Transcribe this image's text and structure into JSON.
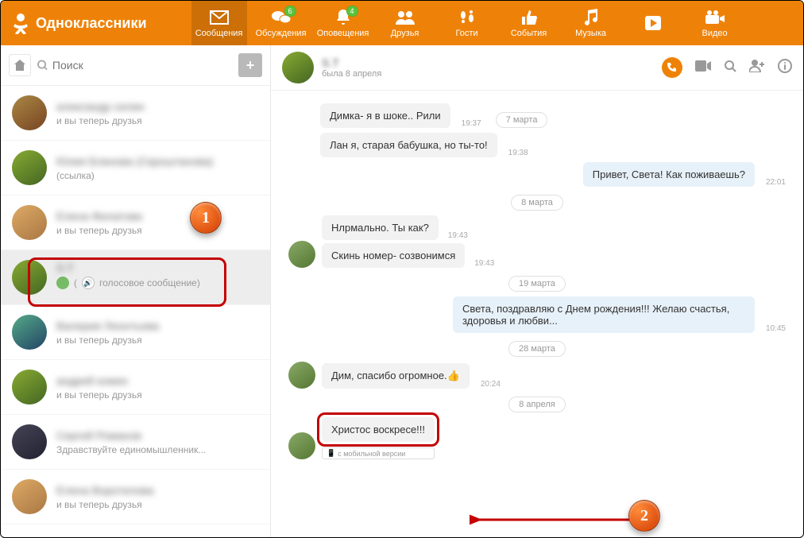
{
  "brand": "Одноклассники",
  "nav": {
    "messages": "Сообщения",
    "discussions": "Обсуждения",
    "notifications": "Оповещения",
    "friends": "Друзья",
    "guests": "Гости",
    "events": "События",
    "music": "Музыка",
    "video": "Видео",
    "badge_discussions": "6",
    "badge_notifications": "4"
  },
  "sidebar": {
    "search_placeholder": "Поиск",
    "contacts": [
      {
        "name": "александр силин",
        "sub": "и вы теперь друзья"
      },
      {
        "name": "Юлия Блинова (Скроштанова)",
        "sub": "(ссылка)"
      },
      {
        "name": "Елена Филатова",
        "sub": "и вы теперь друзья"
      },
      {
        "name": "S.Т",
        "sub": "голосовое сообщение)"
      },
      {
        "name": "Валерия Леонтьева",
        "sub": "и вы теперь друзья"
      },
      {
        "name": "андрей кожин",
        "sub": "и вы теперь друзья"
      },
      {
        "name": "Сергей Романов",
        "sub": "Здравствуйте единомышленник..."
      },
      {
        "name": "Елена Воротилова",
        "sub": "и вы теперь друзья"
      }
    ]
  },
  "chat": {
    "title": "S.Т",
    "sub": "была 8 апреля",
    "rows": {
      "m1": "Димка- я в шоке.. Рили",
      "t1": "19:37",
      "m2": "Лан я, старая бабушка, но ты-то!",
      "t2": "19:38",
      "d1": "7 марта",
      "m3": "Привет, Света! Как поживаешь?",
      "t3": "22:01",
      "d2": "8 марта",
      "m4": "Нлрмально. Ты как?",
      "t4": "19:43",
      "m5": "Скинь номер- созвонимся",
      "t5": "19:43",
      "d3": "19 марта",
      "m6": "Света, поздравляю с Днем рождения!!! Желаю счастья, здоровья и любви...",
      "t6": "10:45",
      "d4": "28 марта",
      "m7": "Дим, спасибо огромное.",
      "t7": "20:24",
      "d5": "8 апреля",
      "m8": "Христос воскресе!!!",
      "mob": "с мобильной версии"
    }
  },
  "markers": {
    "one": "1",
    "two": "2"
  }
}
